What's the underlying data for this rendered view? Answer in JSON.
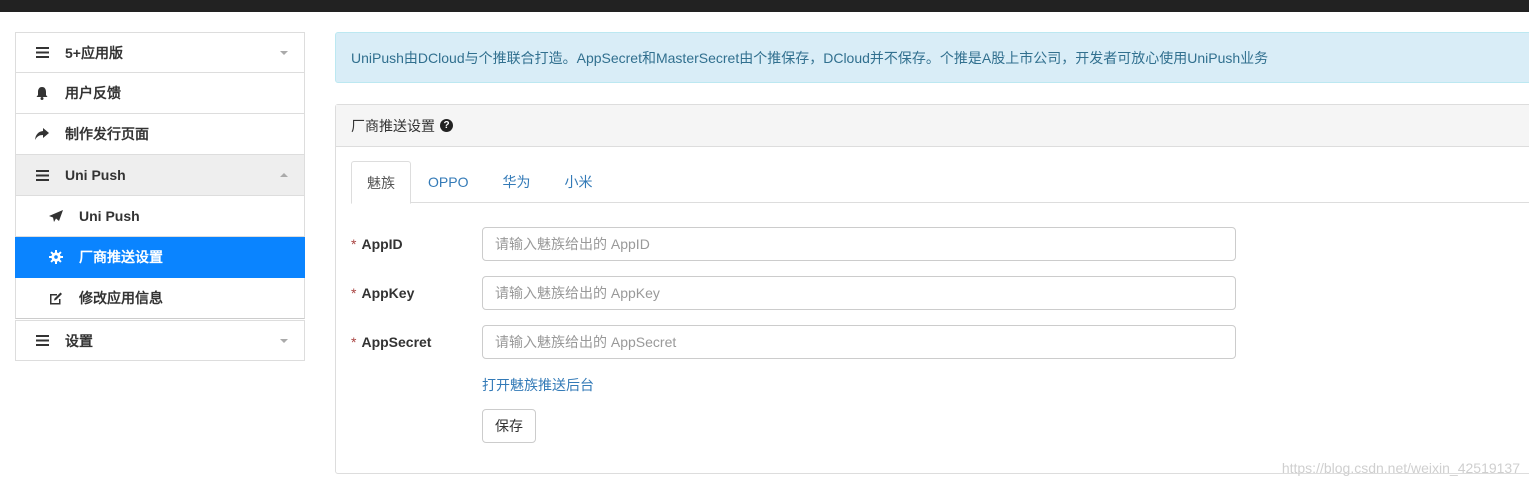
{
  "sidebar": {
    "items": [
      {
        "label": "5+应用版",
        "icon": "list-icon"
      },
      {
        "label": "用户反馈",
        "icon": "bell-icon"
      },
      {
        "label": "制作发行页面",
        "icon": "share-icon"
      },
      {
        "label": "Uni Push",
        "icon": "list-icon"
      },
      {
        "label": "Uni Push",
        "icon": "paper-plane-icon"
      },
      {
        "label": "厂商推送设置",
        "icon": "gear-icon"
      },
      {
        "label": "修改应用信息",
        "icon": "edit-icon"
      },
      {
        "label": "设置",
        "icon": "list-icon"
      }
    ]
  },
  "alert": {
    "text": "UniPush由DCloud与个推联合打造。AppSecret和MasterSecret由个推保存，DCloud并不保存。个推是A股上市公司，开发者可放心使用UniPush业务"
  },
  "panel": {
    "title": "厂商推送设置",
    "help": "?"
  },
  "tabs": [
    {
      "label": "魅族"
    },
    {
      "label": "OPPO"
    },
    {
      "label": "华为"
    },
    {
      "label": "小米"
    }
  ],
  "form": {
    "required_mark": "*",
    "fields": [
      {
        "label": "AppID",
        "placeholder": "请输入魅族给出的 AppID",
        "value": ""
      },
      {
        "label": "AppKey",
        "placeholder": "请输入魅族给出的 AppKey",
        "value": ""
      },
      {
        "label": "AppSecret",
        "placeholder": "请输入魅族给出的 AppSecret",
        "value": ""
      }
    ],
    "link": "打开魅族推送后台",
    "save": "保存"
  },
  "watermark": "https://blog.csdn.net/weixin_42519137",
  "colors": {
    "active_nav": "#0a84ff",
    "link": "#337ab7",
    "alert_bg": "#d9edf7",
    "alert_text": "#31708f",
    "required": "#a94442"
  }
}
